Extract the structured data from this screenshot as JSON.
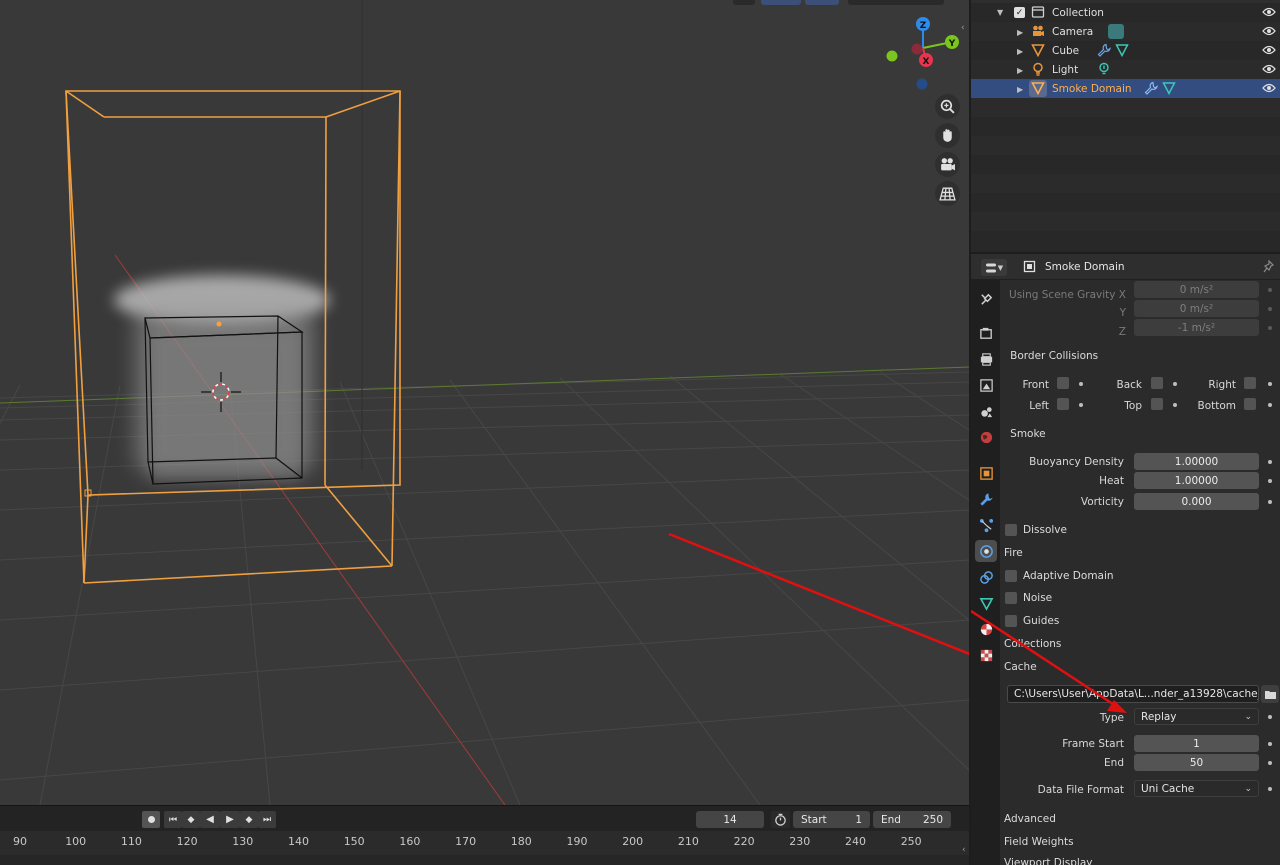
{
  "outliner": {
    "rows": [
      {
        "name": "Collection"
      },
      {
        "name": "Camera"
      },
      {
        "name": "Cube"
      },
      {
        "name": "Light"
      },
      {
        "name": "Smoke Domain"
      }
    ]
  },
  "gizmo": {
    "z": "Z",
    "y": "Y",
    "x": "X"
  },
  "properties": {
    "object_name": "Smoke Domain",
    "gravity": {
      "label_x": "Using Scene Gravity X",
      "label_y": "Y",
      "label_z": "Z",
      "x": "0 m/s²",
      "y": "0 m/s²",
      "z": "-1 m/s²"
    },
    "border_collisions": {
      "title": "Border Collisions",
      "front": "Front",
      "back": "Back",
      "right": "Right",
      "left": "Left",
      "top": "Top",
      "bottom": "Bottom"
    },
    "smoke": {
      "title": "Smoke",
      "buoyancy_label": "Buoyancy Density",
      "buoyancy_value": "1.00000",
      "heat_label": "Heat",
      "heat_value": "1.00000",
      "vorticity_label": "Vorticity",
      "vorticity_value": "0.000"
    },
    "panels": {
      "dissolve": "Dissolve",
      "fire": "Fire",
      "adaptive_domain": "Adaptive Domain",
      "noise": "Noise",
      "guides": "Guides",
      "collections": "Collections",
      "cache": "Cache",
      "advanced": "Advanced",
      "field_weights": "Field Weights",
      "viewport_display": "Viewport Display"
    },
    "cache": {
      "path": "C:\\Users\\User\\AppData\\L...nder_a13928\\cache_fluid",
      "type_label": "Type",
      "type_value": "Replay",
      "frame_start_label": "Frame Start",
      "frame_start_value": "1",
      "end_label": "End",
      "end_value": "50",
      "format_label": "Data File Format",
      "format_value": "Uni Cache"
    }
  },
  "timeline": {
    "current_frame": "14",
    "start_label": "Start",
    "start_value": "1",
    "end_label": "End",
    "end_value": "250",
    "ruler": [
      "90",
      "100",
      "110",
      "120",
      "130",
      "140",
      "150",
      "160",
      "170",
      "180",
      "190",
      "200",
      "210",
      "220",
      "230",
      "240",
      "250"
    ]
  },
  "colors": {
    "selection_orange": "#f0a040",
    "selected_row": "#334d80",
    "annotation_arrow": "#e01010",
    "gizmo_x": "#e8344c",
    "gizmo_y": "#7bc61d",
    "gizmo_z": "#2d8ceb"
  }
}
